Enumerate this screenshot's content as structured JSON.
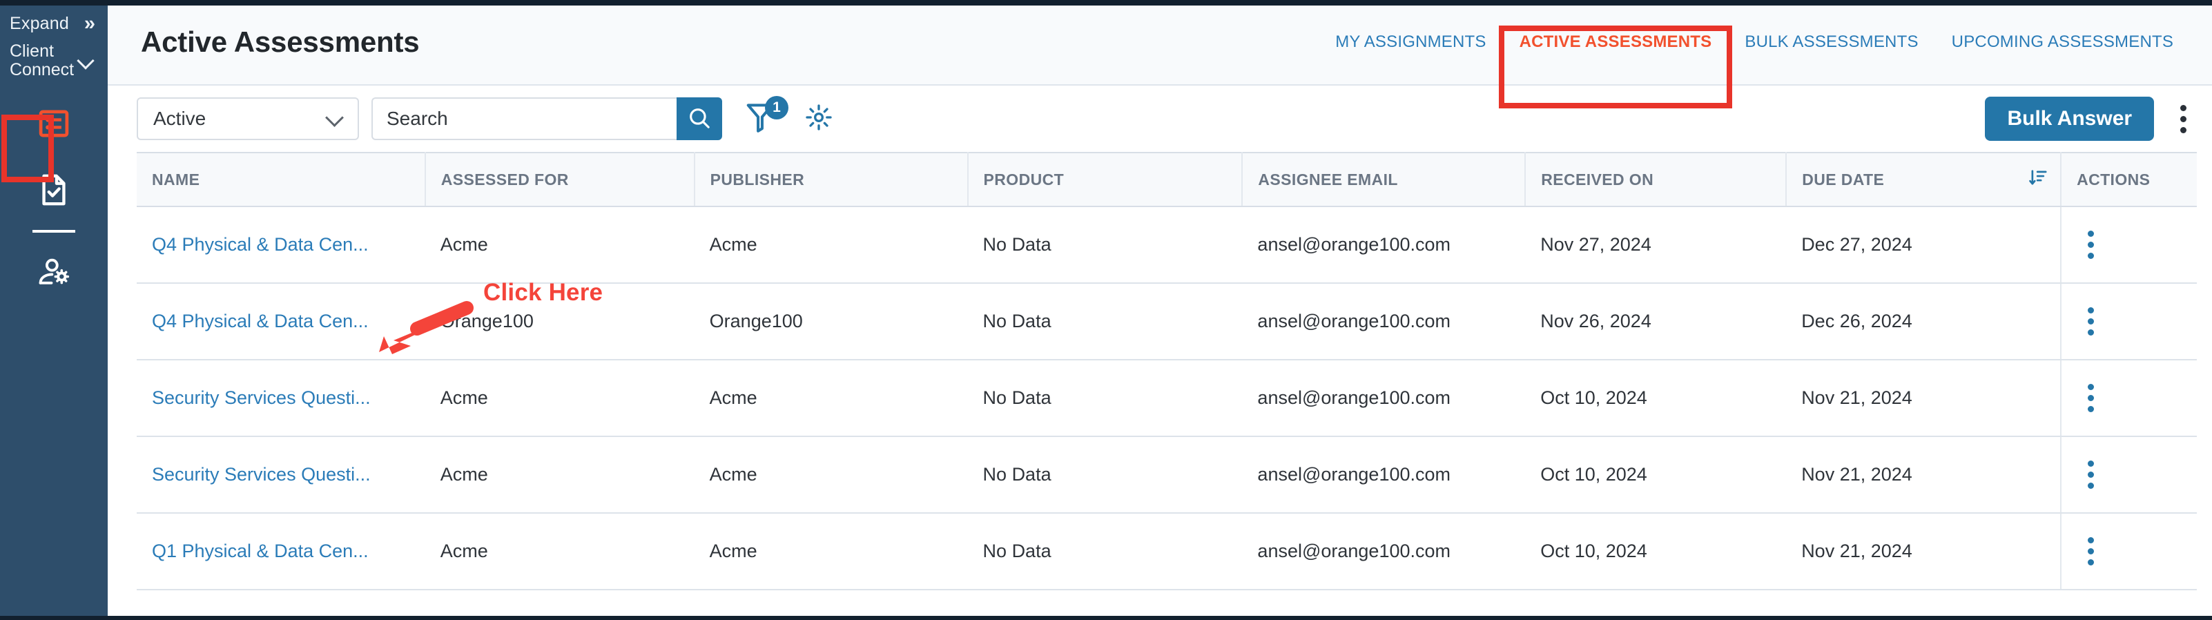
{
  "sidebar": {
    "expand_label": "Expand",
    "expand_icon": "chevron-double-right-icon",
    "client_label": "Client Connect",
    "client_caret_icon": "chevron-down-icon",
    "nav_items": [
      {
        "name": "assessments",
        "icon": "list-checklist-icon",
        "active": true
      },
      {
        "name": "documents",
        "icon": "document-check-icon",
        "active": false
      },
      {
        "name": "user-settings",
        "icon": "user-gear-icon",
        "active": false
      }
    ],
    "bg_color": "#2e4e6b",
    "highlight_color": "#e8342a"
  },
  "header": {
    "title": "Active Assessments",
    "tabs": [
      {
        "label": "MY ASSIGNMENTS",
        "active": false
      },
      {
        "label": "ACTIVE ASSESSMENTS",
        "active": true
      },
      {
        "label": "BULK ASSESSMENTS",
        "active": false
      },
      {
        "label": "UPCOMING ASSESSMENTS",
        "active": false
      }
    ],
    "link_color": "#2b7cb8",
    "active_tab_color": "#f2512e"
  },
  "toolbar": {
    "status_filter": {
      "value": "Active",
      "caret_icon": "chevron-down-icon"
    },
    "search": {
      "value": "",
      "placeholder": "Search",
      "button_icon": "search-icon"
    },
    "filter_icon": "funnel-filter-icon",
    "filter_badge": "1",
    "settings_icon": "gear-icon",
    "bulk_answer_label": "Bulk Answer",
    "overflow_icon": "kebab-menu-icon",
    "accent_color": "#2476a8"
  },
  "table": {
    "columns": [
      "NAME",
      "ASSESSED FOR",
      "PUBLISHER",
      "PRODUCT",
      "ASSIGNEE EMAIL",
      "RECEIVED ON",
      "DUE DATE",
      "ACTIONS"
    ],
    "sorted_column": "DUE DATE",
    "sort_icon": "sort-descending-icon",
    "rows": [
      {
        "name": "Q4 Physical & Data Cen...",
        "assessed_for": "Acme",
        "publisher": "Acme",
        "product": "No Data",
        "assignee_email": "ansel@orange100.com",
        "received_on": "Nov 27, 2024",
        "due_date": "Dec 27, 2024",
        "actions_icon": "kebab-menu-icon"
      },
      {
        "name": "Q4 Physical & Data Cen...",
        "assessed_for": "Orange100",
        "publisher": "Orange100",
        "product": "No Data",
        "assignee_email": "ansel@orange100.com",
        "received_on": "Nov 26, 2024",
        "due_date": "Dec 26, 2024",
        "actions_icon": "kebab-menu-icon"
      },
      {
        "name": "Security Services Questi...",
        "assessed_for": "Acme",
        "publisher": "Acme",
        "product": "No Data",
        "assignee_email": "ansel@orange100.com",
        "received_on": "Oct 10, 2024",
        "due_date": "Nov 21, 2024",
        "actions_icon": "kebab-menu-icon"
      },
      {
        "name": "Security Services Questi...",
        "assessed_for": "Acme",
        "publisher": "Acme",
        "product": "No Data",
        "assignee_email": "ansel@orange100.com",
        "received_on": "Oct 10, 2024",
        "due_date": "Nov 21, 2024",
        "actions_icon": "kebab-menu-icon"
      },
      {
        "name": "Q1 Physical & Data Cen...",
        "assessed_for": "Acme",
        "publisher": "Acme",
        "product": "No Data",
        "assignee_email": "ansel@orange100.com",
        "received_on": "Oct 10, 2024",
        "due_date": "Nov 21, 2024",
        "actions_icon": "kebab-menu-icon"
      }
    ]
  },
  "annotation": {
    "click_here_label": "Click Here",
    "arrow_icon": "arrow-pointing-down-left-icon",
    "color": "#f4443a"
  }
}
